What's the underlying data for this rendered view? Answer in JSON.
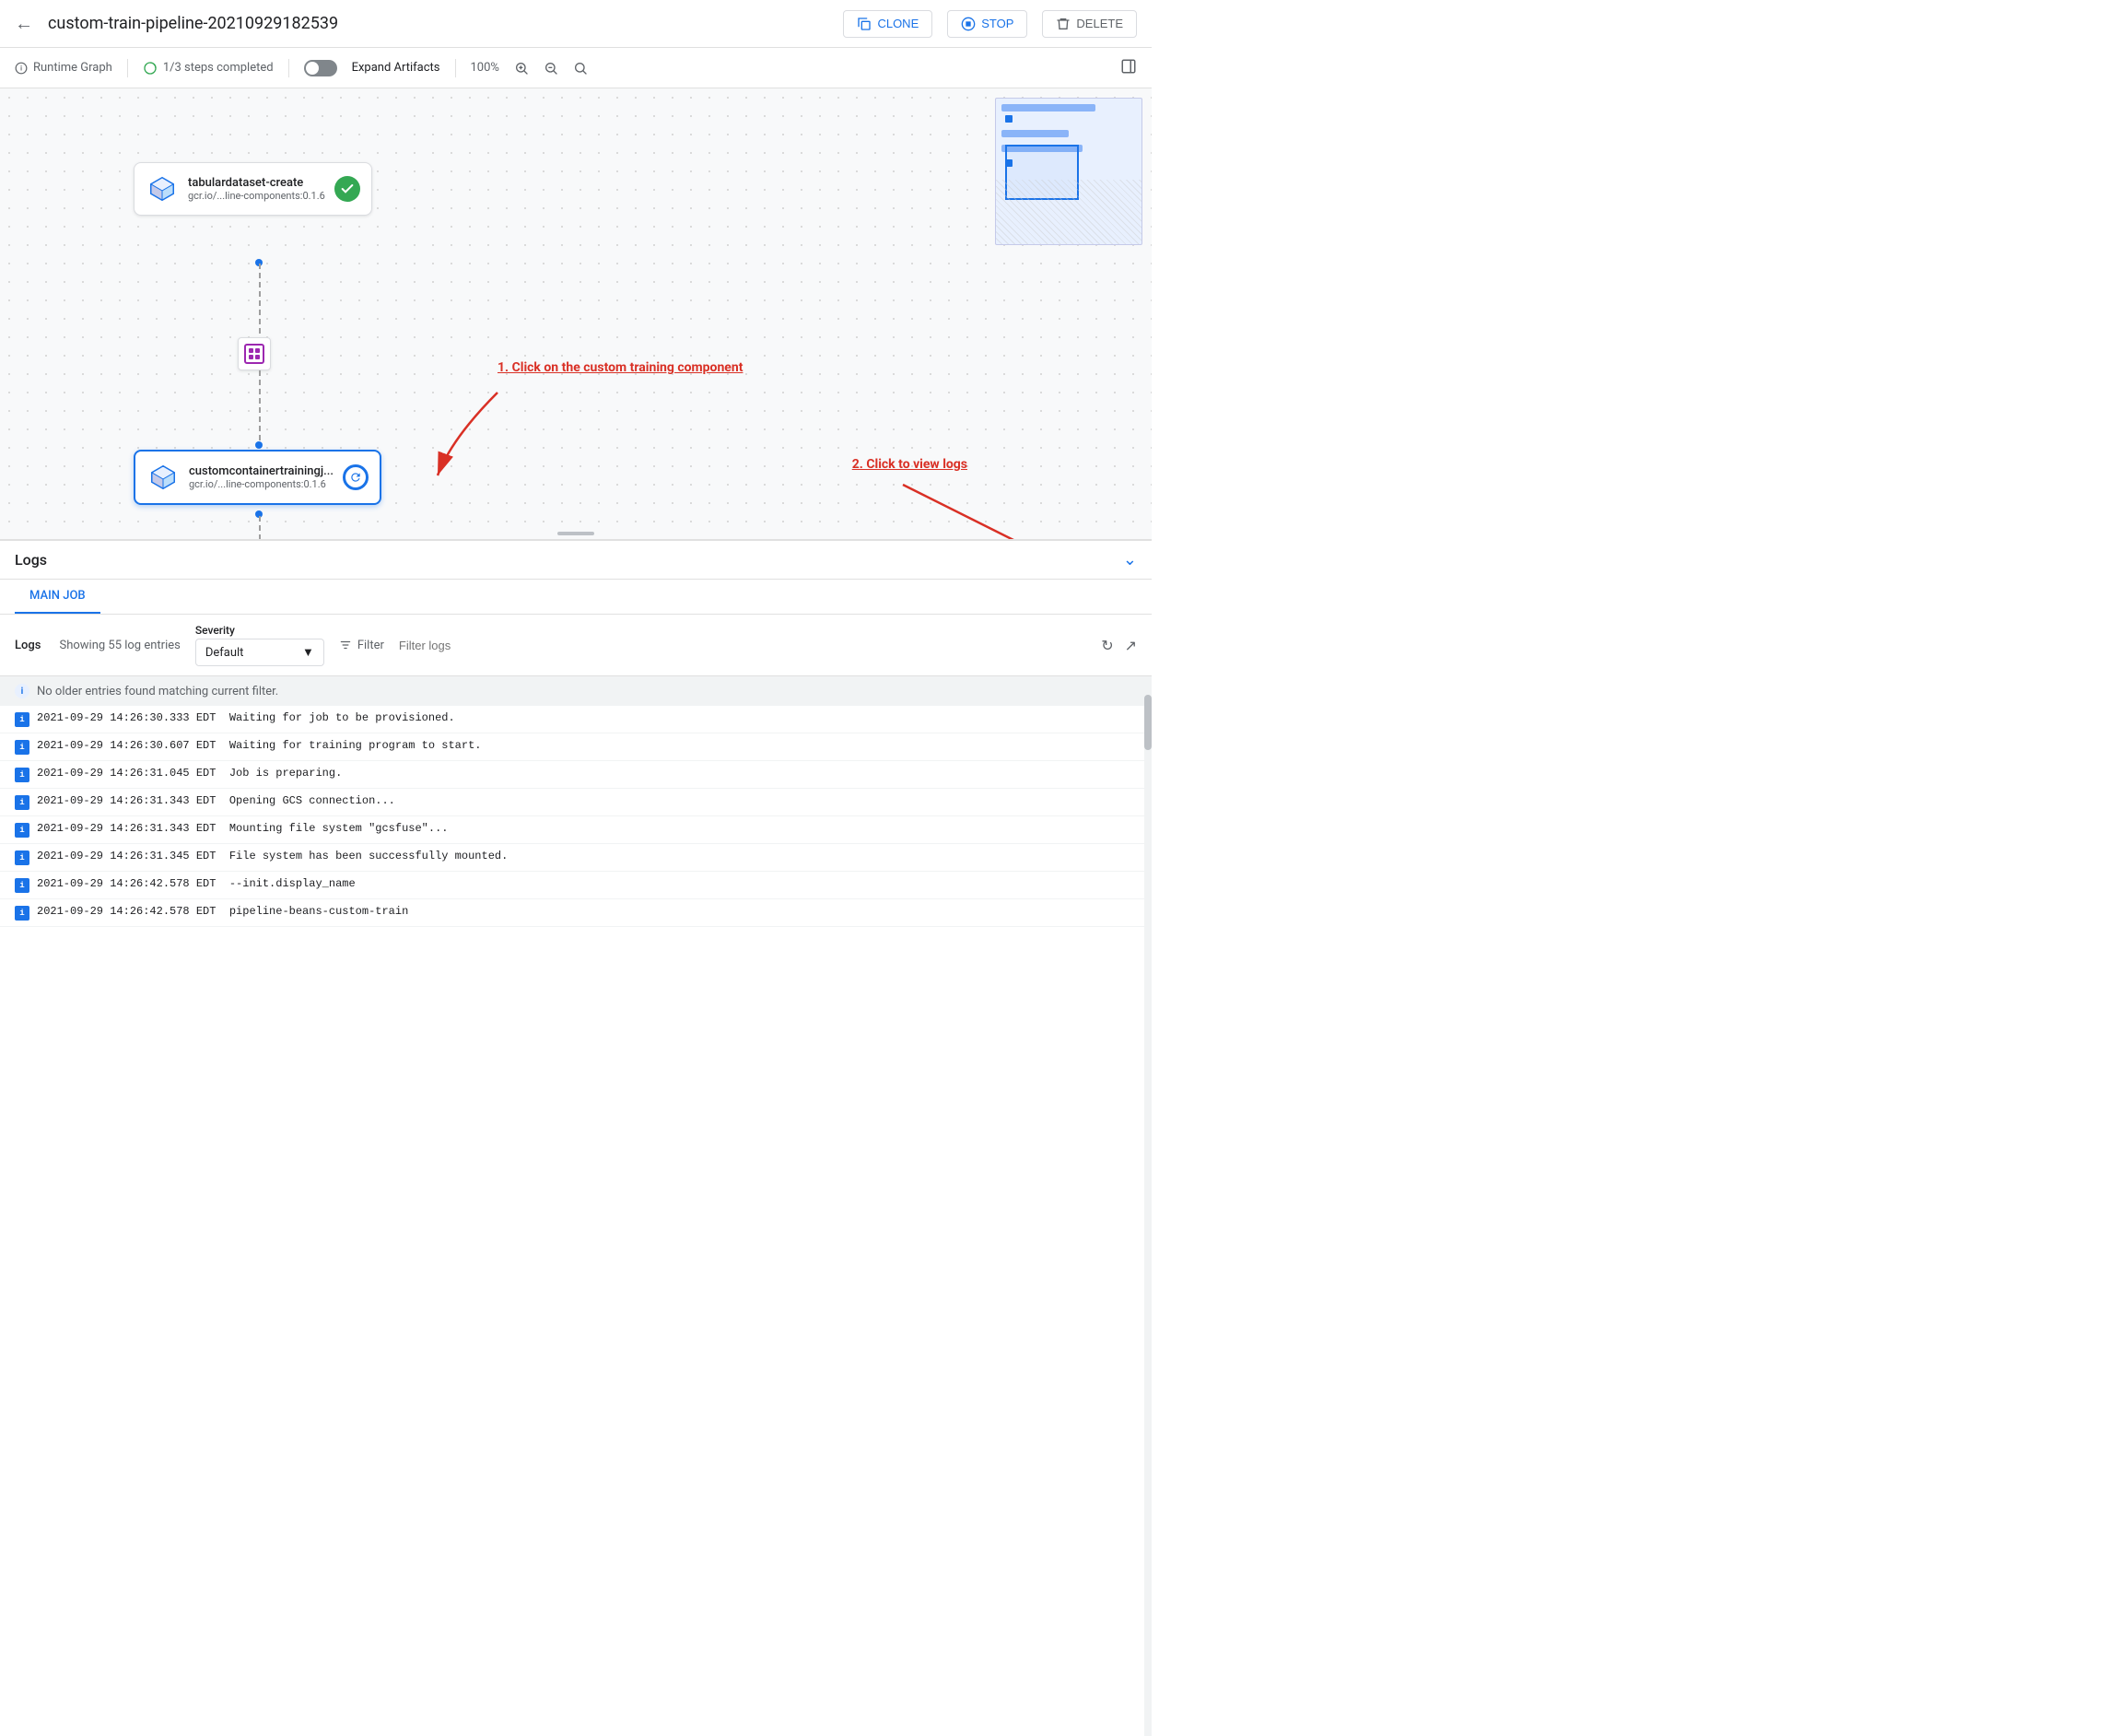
{
  "header": {
    "title": "custom-train-pipeline-20210929182539",
    "back_label": "←",
    "clone_label": "CLONE",
    "stop_label": "STOP",
    "delete_label": "DELETE"
  },
  "toolbar": {
    "runtime_graph_label": "Runtime Graph",
    "steps_completed_label": "1/3 steps completed",
    "expand_artifacts_label": "Expand Artifacts",
    "zoom_level": "100%"
  },
  "pipeline": {
    "node1": {
      "name": "tabulardataset-create",
      "sub": "gcr.io/...line-components:0.1.6",
      "status": "done"
    },
    "node2": {
      "name": "customcontainertrainingj...",
      "sub": "gcr.io/...line-components:0.1.6",
      "status": "running"
    },
    "annotation1": "1. Click on the custom training component",
    "annotation2": "2. Click to view logs"
  },
  "logs": {
    "title": "Logs",
    "tab_main": "MAIN JOB",
    "severity_label": "Severity",
    "severity_value": "Default",
    "logs_count_label": "Logs",
    "logs_count": "Showing 55 log entries",
    "filter_label": "Filter",
    "filter_placeholder": "Filter logs",
    "header_message": "No older entries found matching current filter.",
    "entries": [
      {
        "timestamp": "2021-09-29 14:26:30.333 EDT",
        "message": "Waiting for job to be provisioned."
      },
      {
        "timestamp": "2021-09-29 14:26:30.607 EDT",
        "message": "Waiting for training program to start."
      },
      {
        "timestamp": "2021-09-29 14:26:31.045 EDT",
        "message": "Job is preparing."
      },
      {
        "timestamp": "2021-09-29 14:26:31.343 EDT",
        "message": "Opening GCS connection..."
      },
      {
        "timestamp": "2021-09-29 14:26:31.343 EDT",
        "message": "Mounting file system \"gcsfuse\"..."
      },
      {
        "timestamp": "2021-09-29 14:26:31.345 EDT",
        "message": "File system has been successfully mounted."
      },
      {
        "timestamp": "2021-09-29 14:26:42.578 EDT",
        "message": "--init.display_name"
      },
      {
        "timestamp": "2021-09-29 14:26:42.578 EDT",
        "message": "pipeline-beans-custom-train"
      }
    ]
  }
}
